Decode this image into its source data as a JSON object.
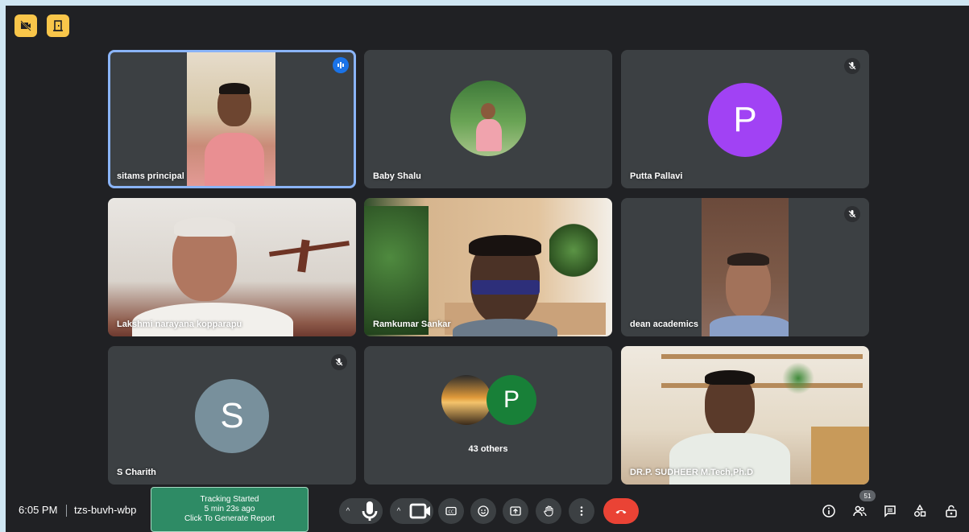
{
  "meeting": {
    "time": "6:05 PM",
    "code": "tzs-buvh-wbp"
  },
  "tracking": {
    "line1": "Tracking Started",
    "line2": "5 min 23s ago",
    "line3": "Click To Generate Report"
  },
  "participants": [
    {
      "name": "sitams principal",
      "state": "speaking"
    },
    {
      "name": "Baby Shalu"
    },
    {
      "name": "Putta Pallavi",
      "letter": "P",
      "muted": true
    },
    {
      "name": "Lakshmi narayana kopparapu"
    },
    {
      "name": "Ramkumar Sankar"
    },
    {
      "name": "dean academics",
      "muted": true
    },
    {
      "name": "S Charith",
      "letter": "S",
      "muted": true
    },
    {
      "name": "43 others",
      "letter": "P"
    },
    {
      "name": "DR.P. SUDHEER M.Tech,Ph.D"
    }
  ],
  "people_count": "51",
  "colors": {
    "accent": "#8ab4f8",
    "end_call": "#ea4335",
    "tracking": "#2e8b65",
    "pallavi_avatar": "#a142f4",
    "charith_avatar": "#78909c",
    "others_avatar": "#188038"
  },
  "icons": [
    "camera-off-icon",
    "door-icon",
    "mic-icon",
    "camera-icon",
    "captions-icon",
    "emoji-icon",
    "present-icon",
    "raise-hand-icon",
    "more-icon",
    "end-call-icon",
    "info-icon",
    "people-icon",
    "chat-icon",
    "activities-icon",
    "host-controls-icon"
  ]
}
